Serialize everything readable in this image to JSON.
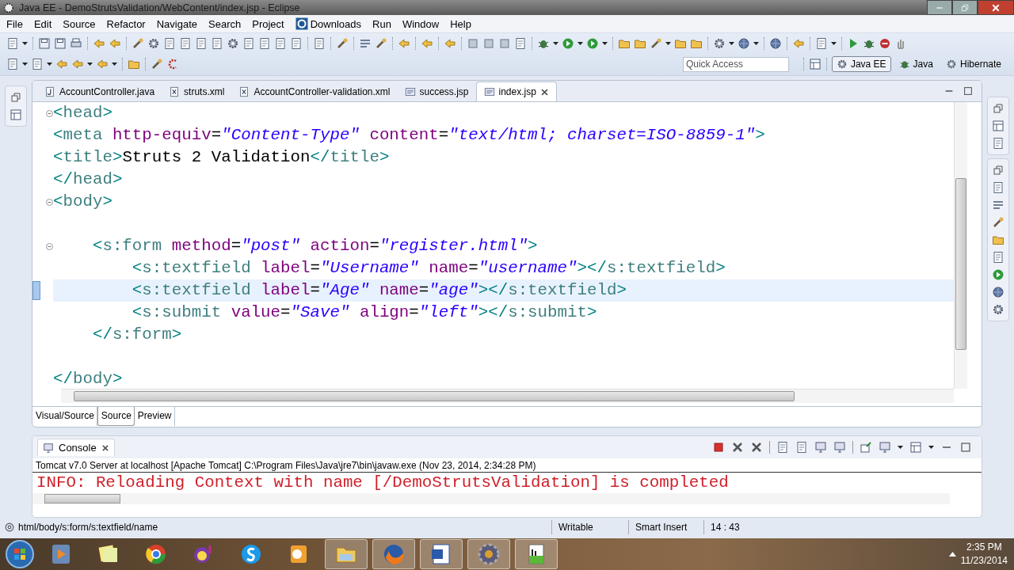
{
  "window": {
    "title": "Java EE - DemoStrutsValidation/WebContent/index.jsp - Eclipse"
  },
  "menu": [
    {
      "label": "File",
      "kind": "plain"
    },
    {
      "label": "Edit",
      "kind": "plain"
    },
    {
      "label": "Source",
      "kind": "plain"
    },
    {
      "label": "Refactor",
      "kind": "plain"
    },
    {
      "label": "Navigate",
      "kind": "plain"
    },
    {
      "label": "Search",
      "kind": "plain"
    },
    {
      "label": "Project",
      "kind": "plain"
    },
    {
      "label": "Downloads",
      "kind": "icon"
    },
    {
      "label": "Run",
      "kind": "plain"
    },
    {
      "label": "Window",
      "kind": "plain"
    },
    {
      "label": "Help",
      "kind": "plain"
    }
  ],
  "quick_access": {
    "placeholder": "Quick Access"
  },
  "perspectives": [
    {
      "label": "Java EE",
      "selected": true
    },
    {
      "label": "Java",
      "selected": false
    },
    {
      "label": "Hibernate",
      "selected": false
    }
  ],
  "editor_tabs": [
    {
      "label": "AccountController.java",
      "kind": "java",
      "selected": false
    },
    {
      "label": "struts.xml",
      "kind": "xml",
      "selected": false
    },
    {
      "label": "AccountController-validation.xml",
      "kind": "xml",
      "selected": false
    },
    {
      "label": "success.jsp",
      "kind": "jsp",
      "selected": false
    },
    {
      "label": "index.jsp",
      "kind": "jsp",
      "selected": true
    }
  ],
  "editor": {
    "lines": [
      {
        "fold": true,
        "current": false,
        "tokens": [
          {
            "kind": "bracket",
            "text": "<"
          },
          {
            "kind": "tag",
            "text": "head"
          },
          {
            "kind": "bracket",
            "text": ">"
          }
        ]
      },
      {
        "fold": false,
        "current": false,
        "tokens": [
          {
            "kind": "bracket",
            "text": "<"
          },
          {
            "kind": "tag",
            "text": "meta"
          },
          {
            "kind": "attr",
            "text": " http-equiv"
          },
          {
            "kind": "plain",
            "text": "="
          },
          {
            "kind": "value",
            "text": "\"Content-Type\""
          },
          {
            "kind": "attr",
            "text": " content"
          },
          {
            "kind": "plain",
            "text": "="
          },
          {
            "kind": "value",
            "text": "\"text/html; charset=ISO-8859-1\""
          },
          {
            "kind": "bracket",
            "text": ">"
          }
        ]
      },
      {
        "fold": false,
        "current": false,
        "tokens": [
          {
            "kind": "bracket",
            "text": "<"
          },
          {
            "kind": "tag",
            "text": "title"
          },
          {
            "kind": "bracket",
            "text": ">"
          },
          {
            "kind": "plain",
            "text": "Struts 2 Validation"
          },
          {
            "kind": "bracket",
            "text": "</"
          },
          {
            "kind": "tag",
            "text": "title"
          },
          {
            "kind": "bracket",
            "text": ">"
          }
        ]
      },
      {
        "fold": false,
        "current": false,
        "tokens": [
          {
            "kind": "bracket",
            "text": "</"
          },
          {
            "kind": "tag",
            "text": "head"
          },
          {
            "kind": "bracket",
            "text": ">"
          }
        ]
      },
      {
        "fold": true,
        "current": false,
        "tokens": [
          {
            "kind": "bracket",
            "text": "<"
          },
          {
            "kind": "tag",
            "text": "body"
          },
          {
            "kind": "bracket",
            "text": ">"
          }
        ]
      },
      {
        "fold": false,
        "current": false
      },
      {
        "fold": true,
        "current": false,
        "tokens": [
          {
            "kind": "bracket",
            "text": "    <"
          },
          {
            "kind": "tag",
            "text": "s:form"
          },
          {
            "kind": "attr",
            "text": " method"
          },
          {
            "kind": "plain",
            "text": "="
          },
          {
            "kind": "value",
            "text": "\"post\""
          },
          {
            "kind": "attr",
            "text": " action"
          },
          {
            "kind": "plain",
            "text": "="
          },
          {
            "kind": "value",
            "text": "\"register.html\""
          },
          {
            "kind": "bracket",
            "text": ">"
          }
        ]
      },
      {
        "fold": false,
        "current": false,
        "tokens": [
          {
            "kind": "bracket",
            "text": "        <"
          },
          {
            "kind": "tag",
            "text": "s:textfield"
          },
          {
            "kind": "attr",
            "text": " label"
          },
          {
            "kind": "plain",
            "text": "="
          },
          {
            "kind": "value",
            "text": "\"Username\""
          },
          {
            "kind": "attr",
            "text": " name"
          },
          {
            "kind": "plain",
            "text": "="
          },
          {
            "kind": "value",
            "text": "\"username\""
          },
          {
            "kind": "bracket",
            "text": "></"
          },
          {
            "kind": "tag",
            "text": "s:textfield"
          },
          {
            "kind": "bracket",
            "text": ">"
          }
        ]
      },
      {
        "fold": false,
        "current": true,
        "tokens": [
          {
            "kind": "bracket",
            "text": "        <"
          },
          {
            "kind": "tag",
            "text": "s:textfield"
          },
          {
            "kind": "attr",
            "text": " label"
          },
          {
            "kind": "plain",
            "text": "="
          },
          {
            "kind": "value",
            "text": "\"Age\""
          },
          {
            "kind": "attr",
            "text": " name"
          },
          {
            "kind": "plain",
            "text": "="
          },
          {
            "kind": "value",
            "text": "\"age\""
          },
          {
            "kind": "bracket",
            "text": "></"
          },
          {
            "kind": "tag",
            "text": "s:textfield"
          },
          {
            "kind": "bracket",
            "text": ">"
          }
        ]
      },
      {
        "fold": false,
        "current": false,
        "tokens": [
          {
            "kind": "bracket",
            "text": "        <"
          },
          {
            "kind": "tag",
            "text": "s:submit"
          },
          {
            "kind": "attr",
            "text": " value"
          },
          {
            "kind": "plain",
            "text": "="
          },
          {
            "kind": "value",
            "text": "\"Save\""
          },
          {
            "kind": "attr",
            "text": " align"
          },
          {
            "kind": "plain",
            "text": "="
          },
          {
            "kind": "value",
            "text": "\"left\""
          },
          {
            "kind": "bracket",
            "text": "></"
          },
          {
            "kind": "tag",
            "text": "s:submit"
          },
          {
            "kind": "bracket",
            "text": ">"
          }
        ]
      },
      {
        "fold": false,
        "current": false,
        "tokens": [
          {
            "kind": "bracket",
            "text": "    </"
          },
          {
            "kind": "tag",
            "text": "s:form"
          },
          {
            "kind": "bracket",
            "text": ">"
          }
        ]
      },
      {
        "fold": false,
        "current": false
      },
      {
        "fold": false,
        "current": false,
        "tokens": [
          {
            "kind": "bracket",
            "text": "</"
          },
          {
            "kind": "tag",
            "text": "body"
          },
          {
            "kind": "bracket",
            "text": ">"
          }
        ]
      }
    ]
  },
  "page_tabs": [
    {
      "label": "Visual/Source",
      "selected": false
    },
    {
      "label": "Source",
      "selected": true
    },
    {
      "label": "Preview",
      "selected": false
    }
  ],
  "console": {
    "title": "Console",
    "process": "Tomcat v7.0 Server at localhost [Apache Tomcat] C:\\Program Files\\Java\\jre7\\bin\\javaw.exe (Nov 23, 2014, 2:34:28 PM)",
    "output": "INFO: Reloading Context with name [/DemoStrutsValidation] is completed"
  },
  "status_bar": {
    "path": "html/body/s:form/s:textfield/name",
    "mode": "Writable",
    "insert": "Smart Insert",
    "position": "14 : 43"
  },
  "taskbar": {
    "time": "2:35 PM",
    "date": "11/23/2014"
  }
}
